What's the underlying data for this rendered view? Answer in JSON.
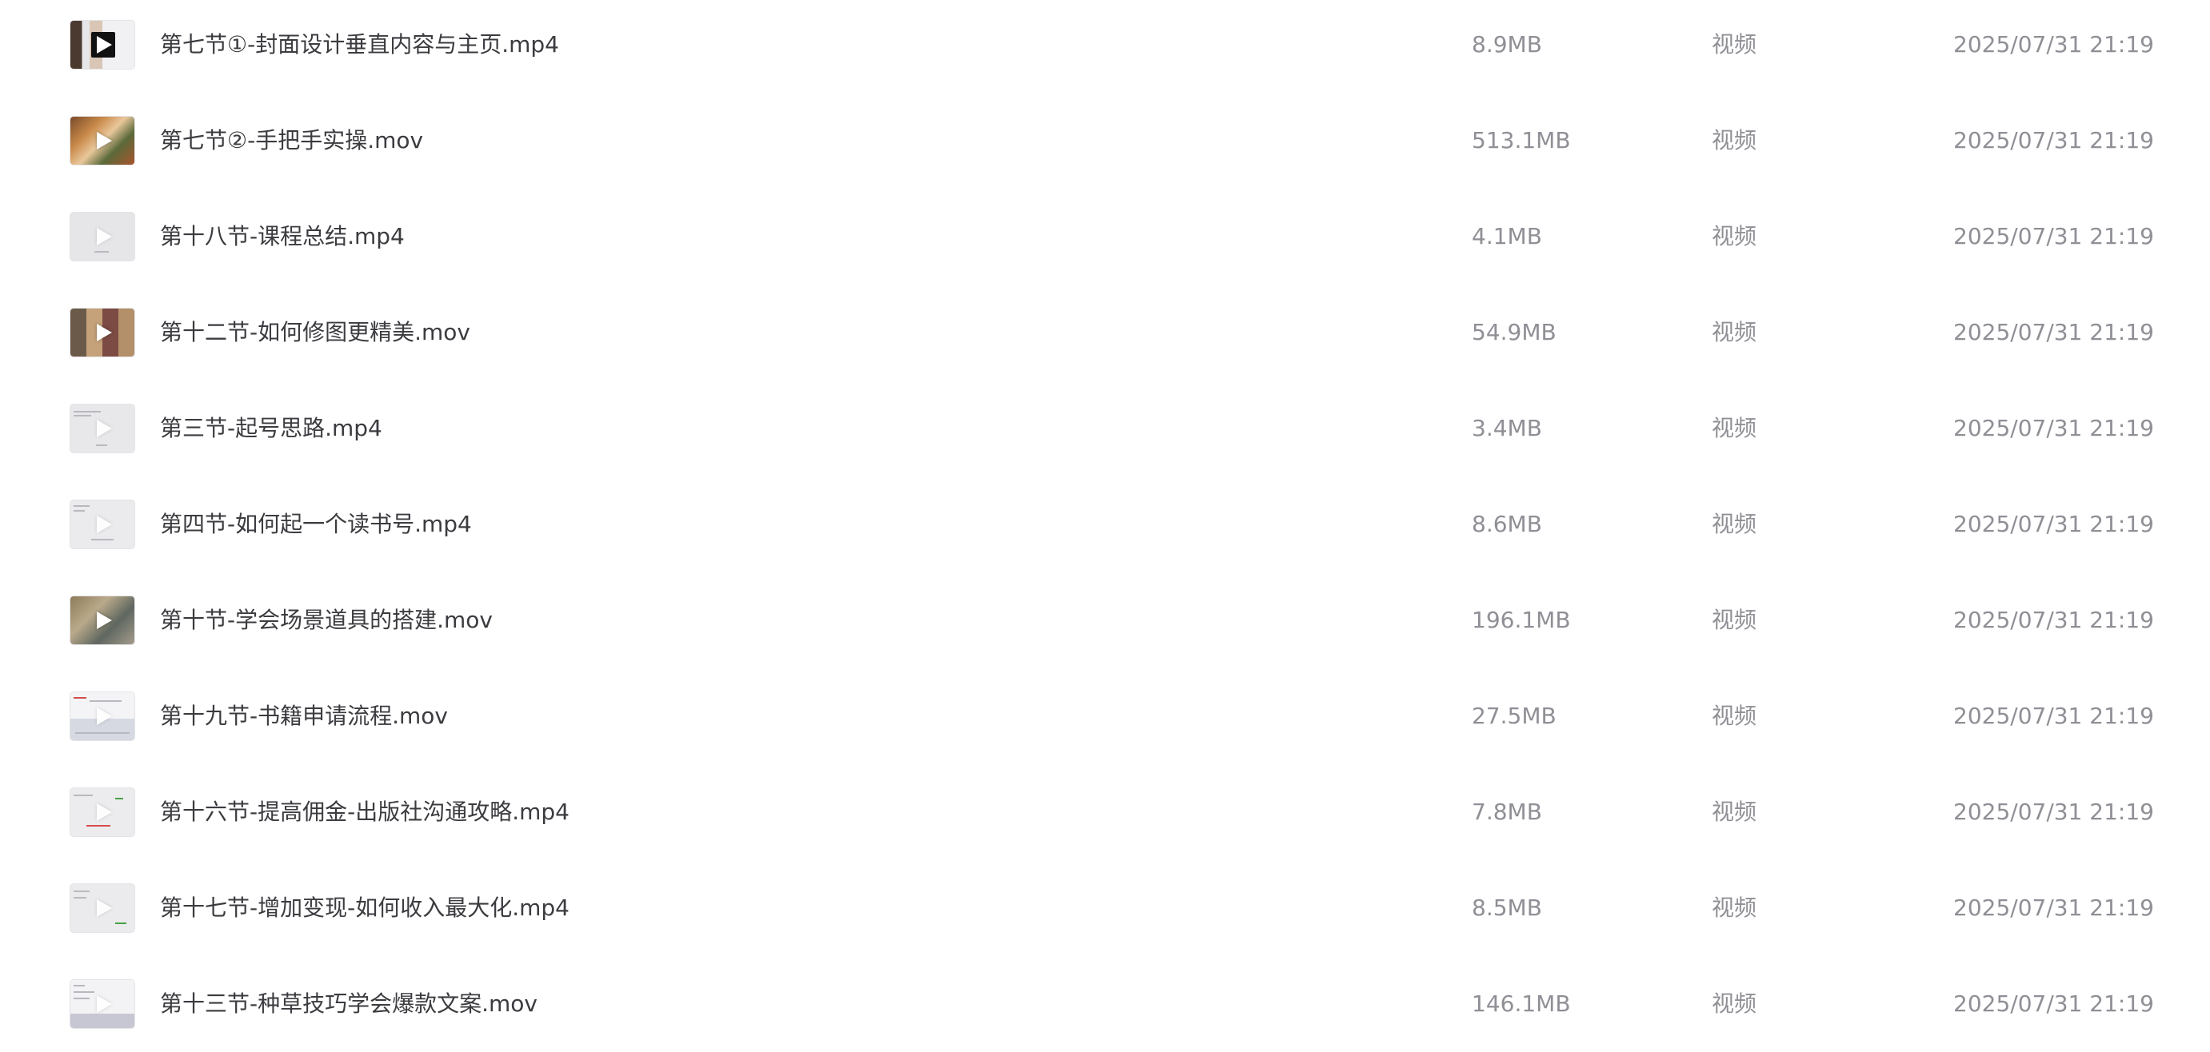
{
  "files": [
    {
      "name": "第七节①-封面设计垂直内容与主页.mp4",
      "size": "8.9MB",
      "type": "视频",
      "modified": "2025/07/31 21:19",
      "thumb_icon": "video-thumbnail-icon"
    },
    {
      "name": "第七节②-手把手实操.mov",
      "size": "513.1MB",
      "type": "视频",
      "modified": "2025/07/31 21:19",
      "thumb_icon": "video-thumbnail-icon"
    },
    {
      "name": "第十八节-课程总结.mp4",
      "size": "4.1MB",
      "type": "视频",
      "modified": "2025/07/31 21:19",
      "thumb_icon": "video-thumbnail-icon"
    },
    {
      "name": "第十二节-如何修图更精美.mov",
      "size": "54.9MB",
      "type": "视频",
      "modified": "2025/07/31 21:19",
      "thumb_icon": "video-thumbnail-icon"
    },
    {
      "name": "第三节-起号思路.mp4",
      "size": "3.4MB",
      "type": "视频",
      "modified": "2025/07/31 21:19",
      "thumb_icon": "video-thumbnail-icon"
    },
    {
      "name": "第四节-如何起一个读书号.mp4",
      "size": "8.6MB",
      "type": "视频",
      "modified": "2025/07/31 21:19",
      "thumb_icon": "video-thumbnail-icon"
    },
    {
      "name": "第十节-学会场景道具的搭建.mov",
      "size": "196.1MB",
      "type": "视频",
      "modified": "2025/07/31 21:19",
      "thumb_icon": "video-thumbnail-icon"
    },
    {
      "name": "第十九节-书籍申请流程.mov",
      "size": "27.5MB",
      "type": "视频",
      "modified": "2025/07/31 21:19",
      "thumb_icon": "video-thumbnail-icon"
    },
    {
      "name": "第十六节-提高佣金-出版社沟通攻略.mp4",
      "size": "7.8MB",
      "type": "视频",
      "modified": "2025/07/31 21:19",
      "thumb_icon": "video-thumbnail-icon"
    },
    {
      "name": "第十七节-增加变现-如何收入最大化.mp4",
      "size": "8.5MB",
      "type": "视频",
      "modified": "2025/07/31 21:19",
      "thumb_icon": "video-thumbnail-icon"
    },
    {
      "name": "第十三节-种草技巧学会爆款文案.mov",
      "size": "146.1MB",
      "type": "视频",
      "modified": "2025/07/31 21:19",
      "thumb_icon": "video-thumbnail-icon"
    }
  ],
  "colors": {
    "name_text": "#3b3b40",
    "meta_text": "#8f8f96",
    "background": "#ffffff"
  }
}
